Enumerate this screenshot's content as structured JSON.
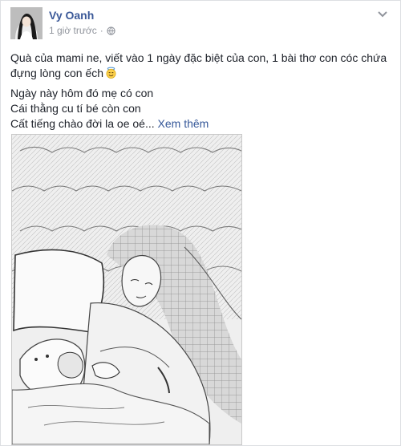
{
  "post": {
    "author_name": "Vy Oanh",
    "timestamp": "1 giờ trước",
    "separator": "·",
    "privacy_icon": "globe-icon",
    "menu_icon": "chevron-down-icon",
    "caption_line1": "Quà của mami ne, viết vào 1 ngày đặc biệt của con, 1 bài thơ con cóc chứa đựng lòng con ếch",
    "caption_emoji": "smiling-face-with-halo-emoji",
    "poem_line1": "Ngày này hôm đó mẹ có con",
    "poem_line2": "Cái thằng cu tí bé còn con",
    "poem_line3": "Cất tiếng chào đời la oe oé...",
    "see_more_label": "Xem thêm"
  },
  "colors": {
    "author_link": "#3b5998",
    "see_more_link": "#365899",
    "text": "#1d2129",
    "meta": "#90949c"
  }
}
